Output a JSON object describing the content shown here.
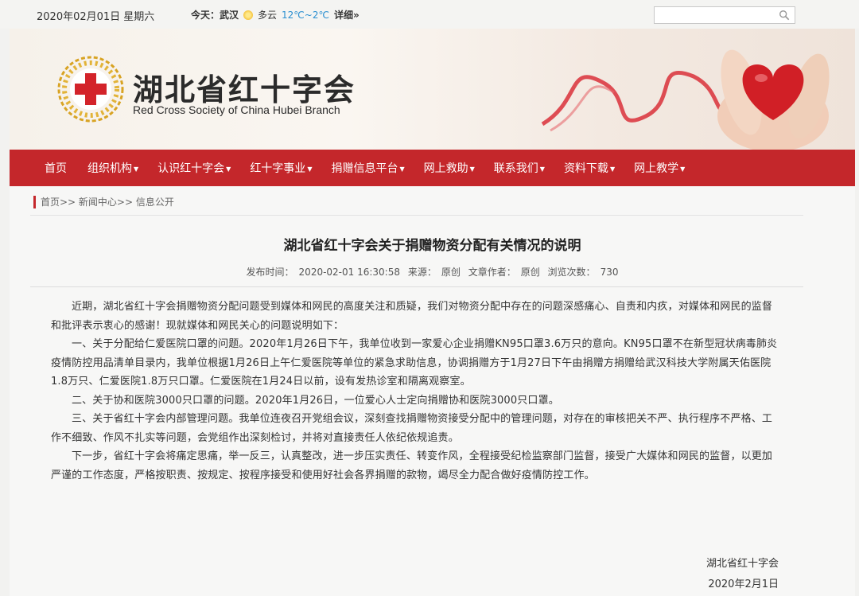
{
  "topbar": {
    "date": "2020年02月01日 星期六",
    "today_label": "今天：武汉",
    "weather": "多云",
    "temperature": "12℃~2℃",
    "detail_link": "详细»",
    "search_placeholder": ""
  },
  "banner": {
    "title_cn": "湖北省红十字会",
    "title_en": "Red Cross Society of China Hubei Branch",
    "accent_color": "#c4272b"
  },
  "nav": {
    "items": [
      {
        "label": "首页",
        "dropdown": false
      },
      {
        "label": "组织机构",
        "dropdown": true
      },
      {
        "label": "认识红十字会",
        "dropdown": true
      },
      {
        "label": "红十字事业",
        "dropdown": true
      },
      {
        "label": "捐赠信息平台",
        "dropdown": true
      },
      {
        "label": "网上救助",
        "dropdown": true
      },
      {
        "label": "联系我们",
        "dropdown": true
      },
      {
        "label": "资料下载",
        "dropdown": true
      },
      {
        "label": "网上教学",
        "dropdown": true
      }
    ]
  },
  "breadcrumb": "首页>> 新闻中心>> 信息公开",
  "article": {
    "title": "湖北省红十字会关于捐赠物资分配有关情况的说明",
    "meta": {
      "publish_label": "发布时间：",
      "publish_time": "2020-02-01 16:30:58",
      "source_label": "来源：",
      "source": "原创",
      "author_label": "文章作者：",
      "author": "原创",
      "views_label": "浏览次数：",
      "views": "730"
    },
    "paragraphs": [
      "近期，湖北省红十字会捐赠物资分配问题受到媒体和网民的高度关注和质疑，我们对物资分配中存在的问题深感痛心、自责和内疚，对媒体和网民的监督和批评表示衷心的感谢！现就媒体和网民关心的问题说明如下：",
      "一、关于分配给仁爱医院口罩的问题。2020年1月26日下午，我单位收到一家爱心企业捐赠KN95口罩3.6万只的意向。KN95口罩不在新型冠状病毒肺炎疫情防控用品清单目录内，我单位根据1月26日上午仁爱医院等单位的紧急求助信息，协调捐赠方于1月27日下午由捐赠方捐赠给武汉科技大学附属天佑医院1.8万只、仁爱医院1.8万只口罩。仁爱医院在1月24日以前，设有发热诊室和隔离观察室。",
      "二、关于协和医院3000只口罩的问题。2020年1月26日，一位爱心人士定向捐赠协和医院3000只口罩。",
      "三、关于省红十字会内部管理问题。我单位连夜召开党组会议，深刻查找捐赠物资接受分配中的管理问题，对存在的审核把关不严、执行程序不严格、工作不细致、作风不扎实等问题，会党组作出深刻检讨，并将对直接责任人依纪依规追责。",
      "下一步，省红十字会将痛定思痛，举一反三，认真整改，进一步压实责任、转变作风，全程接受纪检监察部门监督，接受广大媒体和网民的监督，以更加严谨的工作态度，严格按职责、按规定、按程序接受和使用好社会各界捐赠的款物，竭尽全力配合做好疫情防控工作。"
    ],
    "signature_org": "湖北省红十字会",
    "signature_date": "2020年2月1日"
  }
}
